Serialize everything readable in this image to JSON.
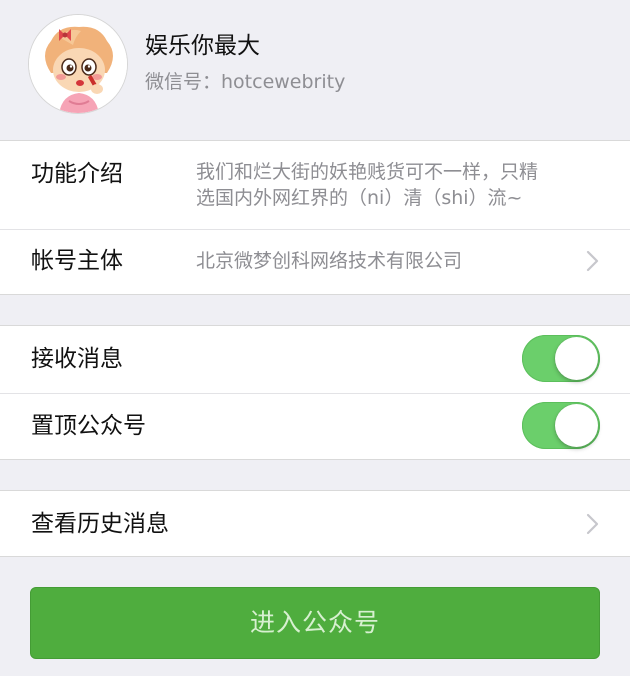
{
  "profile": {
    "name": "娱乐你最大",
    "wechat_id": "微信号：hotcewebrity"
  },
  "info": {
    "intro_label": "功能介绍",
    "intro_line1": "我们和烂大街的妖艳贱货可不一样，只精",
    "intro_line2": "选国内外网红界的（ni）清（shi）流~",
    "account_label": "帐号主体",
    "account_value": "北京微梦创科网络技术有限公司"
  },
  "settings": {
    "receive_label": "接收消息",
    "receive_on": true,
    "pin_label": "置顶公众号",
    "pin_on": true
  },
  "history": {
    "label": "查看历史消息"
  },
  "enter_button": {
    "label": "进入公众号"
  },
  "colors": {
    "toggle_on": "#6bcf6b",
    "button": "#4fad3e",
    "background": "#efeff4"
  },
  "icons": [
    "avatar",
    "chevron-right-icon",
    "chevron-right-icon"
  ]
}
